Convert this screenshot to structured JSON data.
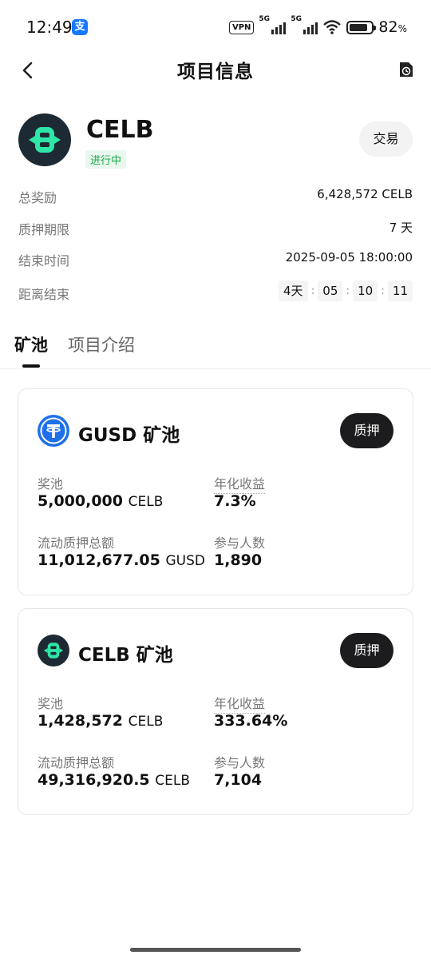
{
  "status_bar": {
    "time": "12:49",
    "alipay_glyph": "支",
    "vpn": "VPN",
    "net1": "5G",
    "net2": "5G",
    "battery_pct": "82",
    "battery_sym": "%"
  },
  "header": {
    "title": "项目信息"
  },
  "project": {
    "name": "CELB",
    "status": "进行中",
    "trade_label": "交易",
    "info": [
      {
        "label": "总奖励",
        "value": "6,428,572 CELB"
      },
      {
        "label": "质押期限",
        "value": "7 天"
      },
      {
        "label": "结束时间",
        "value": "2025-09-05 18:00:00"
      }
    ],
    "countdown": {
      "label": "距离结束",
      "days": "4天",
      "hours": "05",
      "minutes": "10",
      "seconds": "11",
      "sep": ":"
    }
  },
  "tabs": [
    {
      "label": "矿池"
    },
    {
      "label": "项目介绍"
    }
  ],
  "pools": [
    {
      "title": "GUSD 矿池",
      "stake_label": "质押",
      "reward_label": "奖池",
      "reward_value": "5,000,000",
      "reward_unit": "CELB",
      "apy_label": "年化收益",
      "apy_value": "7.3%",
      "staked_label": "流动质押总额",
      "staked_value": "11,012,677.05",
      "staked_unit": "GUSD",
      "participants_label": "参与人数",
      "participants_value": "1,890"
    },
    {
      "title": "CELB 矿池",
      "stake_label": "质押",
      "reward_label": "奖池",
      "reward_value": "1,428,572",
      "reward_unit": "CELB",
      "apy_label": "年化收益",
      "apy_value": "333.64%",
      "staked_label": "流动质押总额",
      "staked_value": "49,316,920.5",
      "staked_unit": "CELB",
      "participants_label": "参与人数",
      "participants_value": "7,104"
    }
  ],
  "colors": {
    "accent_green": "#2ee6a6",
    "logo_dark": "#1e2a33",
    "status_green": "#1aa84a",
    "gusd_blue": "#1e6fe8"
  }
}
